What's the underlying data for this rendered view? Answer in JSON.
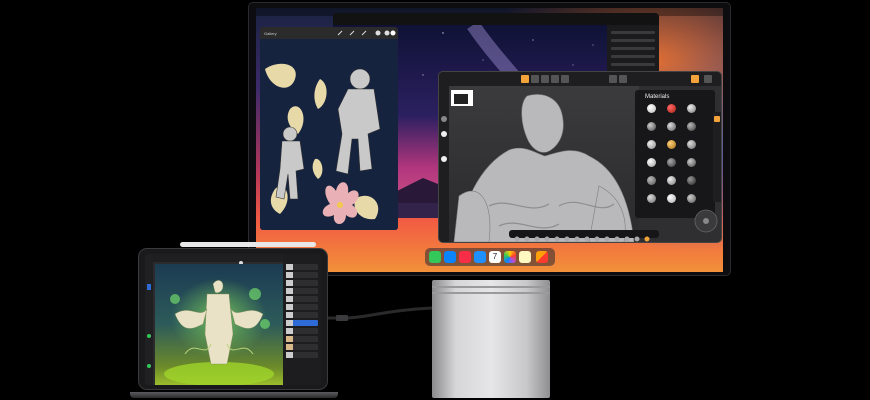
{
  "monitor": {
    "menubar": {
      "app_name": "",
      "menu_items": []
    },
    "procreate_window": {
      "tab_label": "Gallery"
    },
    "sculpt_window": {
      "materials_panel_title": "Materials"
    }
  },
  "dock": {
    "icons": [
      {
        "name": "messages-icon",
        "color": "#34c759"
      },
      {
        "name": "safari-icon",
        "color": "#0a84ff"
      },
      {
        "name": "music-icon",
        "color": "#fa2d48"
      },
      {
        "name": "mail-icon",
        "color": "#1e90ff"
      },
      {
        "name": "calendar-icon",
        "color": "#ffffff",
        "text": "7"
      },
      {
        "name": "photos-icon",
        "color": "#ffcc00"
      },
      {
        "name": "notes-icon",
        "color": "#fff8c0"
      },
      {
        "name": "app-library-icon",
        "color": "#ff9f0a"
      }
    ]
  },
  "colors": {
    "accent_orange": "#f2a33a",
    "wallpaper_red": "#e5484d",
    "wallpaper_orange": "#f2913a"
  }
}
